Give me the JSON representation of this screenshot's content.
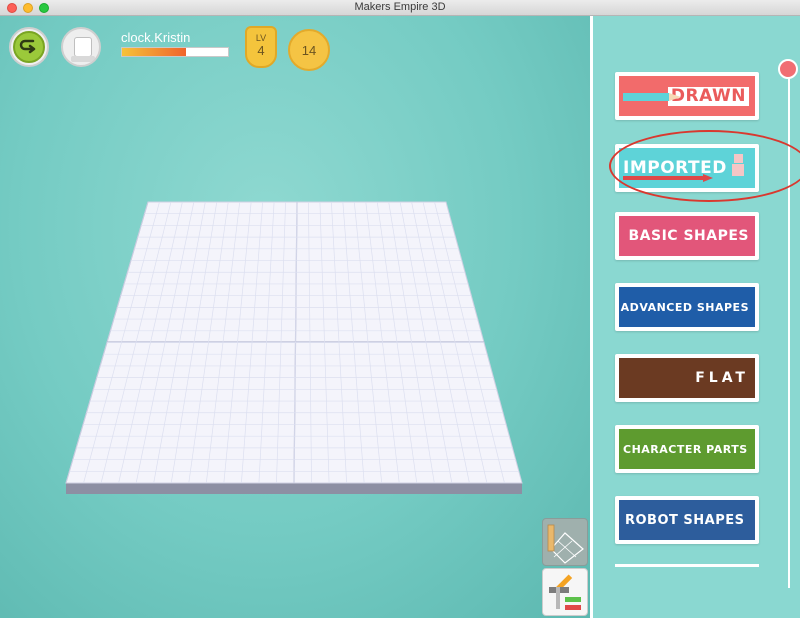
{
  "window": {
    "title": "Makers Empire 3D"
  },
  "hud": {
    "username": "clock.Kristin",
    "xp_progress_percent": 60,
    "level_label": "LV",
    "level_value": "4",
    "coins": "14"
  },
  "panel": {
    "categories": [
      {
        "label": "DRAWN",
        "color": "#f26b6b"
      },
      {
        "label": "IMPORTED",
        "color": "#5ed3d8"
      },
      {
        "label": "BASIC SHAPES",
        "color": "#e2567a"
      },
      {
        "label": "ADVANCED SHAPES",
        "color": "#1f5da8"
      },
      {
        "label": "FLAT",
        "color": "#6b3a22"
      },
      {
        "label": "CHARACTER PARTS",
        "color": "#5e9b2f"
      },
      {
        "label": "ROBOT SHAPES",
        "color": "#2d5d9c"
      }
    ],
    "highlighted_category": "IMPORTED",
    "scrollbar_accent": "#f16e73"
  },
  "icons": {
    "back": "back-arrow-icon",
    "grid_tool": "grid-ruler-icon",
    "edit_tools": "pencil-hammer-screwdriver-icon"
  }
}
